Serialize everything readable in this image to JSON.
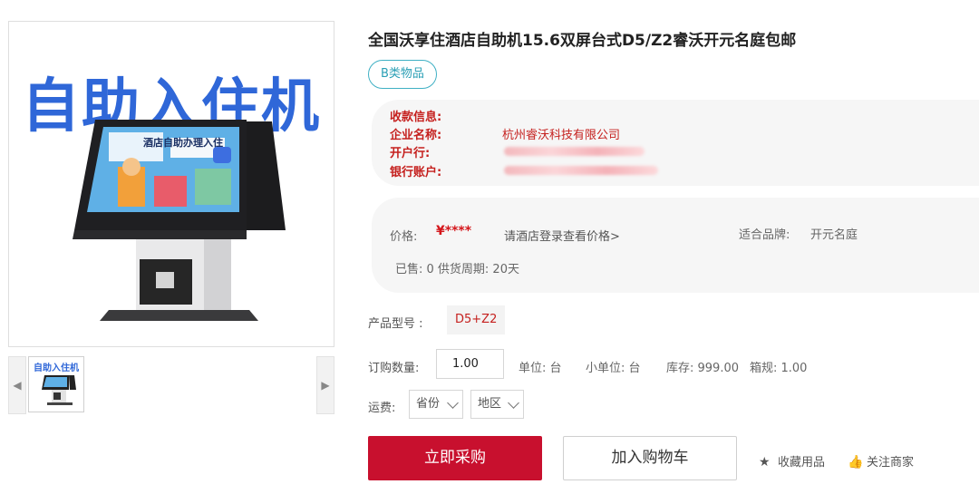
{
  "gallery": {
    "main_caption": "自助入住机",
    "screen_caption": "酒店自助办理入住",
    "thumb_caption": "自助入住机"
  },
  "product": {
    "title": "全国沃享住酒店自助机15.6双屏台式D5/Z2睿沃开元名庭包邮",
    "tag": "B类物品"
  },
  "payment": {
    "header": "收款信息:",
    "company_label": "企业名称:",
    "company_value": "杭州睿沃科技有限公司",
    "bank_label": "开户行:",
    "account_label": "银行账户:"
  },
  "pricing": {
    "price_label": "价格:",
    "price_value": "¥****",
    "login_link": "请酒店登录查看价格>",
    "brand_label": "适合品牌:",
    "brand_value": "开元名庭",
    "sold_info": "已售: 0 供货周期: 20天"
  },
  "model": {
    "label": "产品型号 :",
    "value": "D5+Z2"
  },
  "quantity": {
    "label": "订购数量:",
    "value": "1.00",
    "unit": "单位: 台",
    "sub_unit": "小单位: 台",
    "stock": "库存: 999.00",
    "box_spec": "箱规: 1.00"
  },
  "shipping": {
    "label": "运费:",
    "province": "省份",
    "region": "地区"
  },
  "actions": {
    "buy": "立即采购",
    "cart": "加入购物车",
    "favorite": "收藏用品",
    "follow": "关注商家"
  },
  "colors": {
    "accent_red": "#c8102e",
    "brand_blue": "#2f67d8",
    "tag_teal": "#2a9fb5"
  },
  "icons": {
    "thumb_left": "chevron-left-icon",
    "thumb_right": "chevron-right-icon",
    "favorite": "star-icon",
    "follow": "thumbs-up-icon"
  }
}
